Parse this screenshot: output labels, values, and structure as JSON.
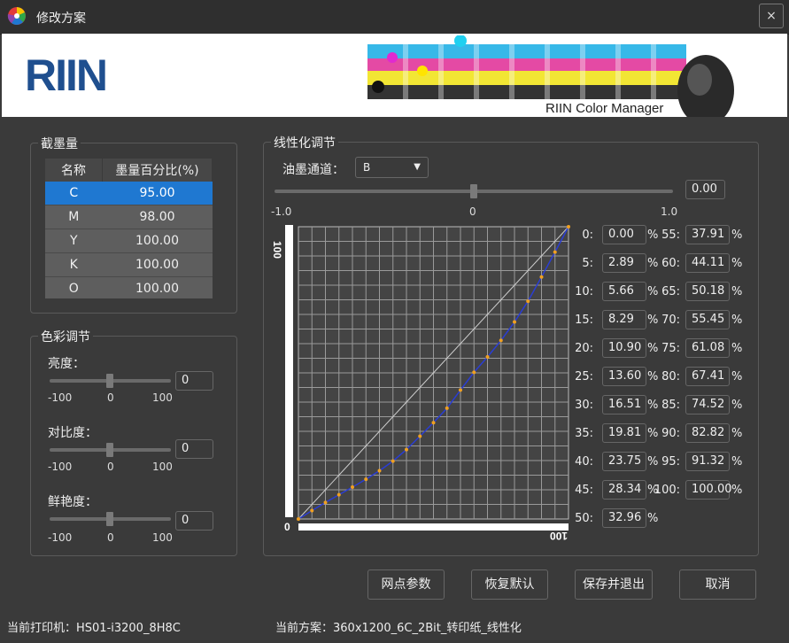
{
  "window": {
    "title": "修改方案",
    "close": "×"
  },
  "banner": {
    "logo": "RIIN",
    "product": "RIIN Color Manager"
  },
  "ink_group": {
    "title": "截墨量",
    "headers": [
      "名称",
      "墨量百分比(%)"
    ],
    "rows": [
      {
        "name": "C",
        "value": "95.00"
      },
      {
        "name": "M",
        "value": "98.00"
      },
      {
        "name": "Y",
        "value": "100.00"
      },
      {
        "name": "K",
        "value": "100.00"
      },
      {
        "name": "O",
        "value": "100.00"
      }
    ]
  },
  "color_group": {
    "title": "色彩调节",
    "brightness": {
      "label": "亮度：",
      "value": "0",
      "level": 0
    },
    "contrast": {
      "label": "对比度：",
      "value": "0",
      "level": 0
    },
    "saturation": {
      "label": "鲜艳度：",
      "value": "0",
      "level": 0
    },
    "ticks": [
      "-100",
      "0",
      "100"
    ]
  },
  "linear_group": {
    "title": "线性化调节",
    "channel_label": "油墨通道：",
    "channel_value": "B",
    "slider_value": "0.00",
    "slider_level": 0,
    "slider_ticks": [
      "-1.0",
      "0",
      "1.0"
    ],
    "axis": {
      "y_top": "100",
      "origin": "0",
      "x_right": "100"
    },
    "percent_sign": "%",
    "values_left": [
      {
        "label": "0:",
        "value": "0.00"
      },
      {
        "label": "5:",
        "value": "2.89"
      },
      {
        "label": "10:",
        "value": "5.66"
      },
      {
        "label": "15:",
        "value": "8.29"
      },
      {
        "label": "20:",
        "value": "10.90"
      },
      {
        "label": "25:",
        "value": "13.60"
      },
      {
        "label": "30:",
        "value": "16.51"
      },
      {
        "label": "35:",
        "value": "19.81"
      },
      {
        "label": "40:",
        "value": "23.75"
      },
      {
        "label": "45:",
        "value": "28.34"
      },
      {
        "label": "50:",
        "value": "32.96"
      }
    ],
    "values_right": [
      {
        "label": "55:",
        "value": "37.91"
      },
      {
        "label": "60:",
        "value": "44.11"
      },
      {
        "label": "65:",
        "value": "50.18"
      },
      {
        "label": "70:",
        "value": "55.45"
      },
      {
        "label": "75:",
        "value": "61.08"
      },
      {
        "label": "80:",
        "value": "67.41"
      },
      {
        "label": "85:",
        "value": "74.52"
      },
      {
        "label": "90:",
        "value": "82.82"
      },
      {
        "label": "95:",
        "value": "91.32"
      },
      {
        "label": "100:",
        "value": "100.00"
      }
    ]
  },
  "buttons": {
    "dot": "网点参数",
    "restore": "恢复默认",
    "save": "保存并退出",
    "cancel": "取消"
  },
  "status": {
    "printer": "当前打印机：HS01-i3200_8H8C",
    "scheme": "当前方案：360x1200_6C_2Bit_转印纸_线性化"
  },
  "chart_data": {
    "type": "line",
    "xlim": [
      0,
      100
    ],
    "ylim": [
      0,
      100
    ],
    "grid": true,
    "series": [
      {
        "x": [
          0,
          5,
          10,
          15,
          20,
          25,
          30,
          35,
          40,
          45,
          50,
          55,
          60,
          65,
          70,
          75,
          80,
          85,
          90,
          95,
          100
        ],
        "y": [
          0,
          2.89,
          5.66,
          8.29,
          10.9,
          13.6,
          16.51,
          19.81,
          23.75,
          28.34,
          32.96,
          37.91,
          44.11,
          50.18,
          55.45,
          61.08,
          67.41,
          74.52,
          82.82,
          91.32,
          100
        ]
      }
    ]
  }
}
